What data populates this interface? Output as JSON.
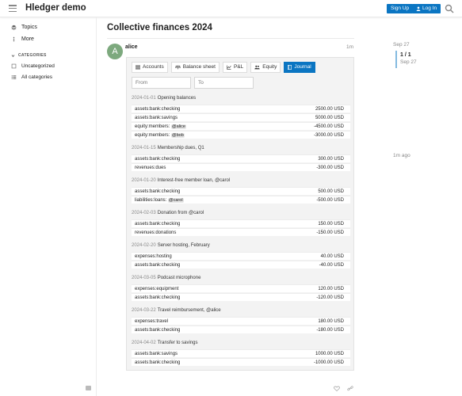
{
  "header": {
    "site_title": "Hledger demo",
    "signup_label": "Sign Up",
    "login_label": "Log In"
  },
  "sidebar": {
    "items": [
      {
        "label": "Topics",
        "icon": "layers-icon"
      },
      {
        "label": "More",
        "icon": "vertical-dots-icon"
      }
    ],
    "section_label": "CATEGORIES",
    "categories": [
      {
        "label": "Uncategorized",
        "icon": "square-icon"
      },
      {
        "label": "All categories",
        "icon": "list-icon"
      }
    ]
  },
  "topic": {
    "title": "Collective finances 2024"
  },
  "post": {
    "avatar_letter": "A",
    "username": "alice",
    "time": "1m",
    "tabs": [
      {
        "label": "Accounts",
        "icon": "list-icon",
        "active": false
      },
      {
        "label": "Balance sheet",
        "icon": "scale-icon",
        "active": false
      },
      {
        "label": "P&L",
        "icon": "chart-line-icon",
        "active": false
      },
      {
        "label": "Equity",
        "icon": "users-icon",
        "active": false
      },
      {
        "label": "Journal",
        "icon": "book-icon",
        "active": true
      }
    ],
    "from_placeholder": "From",
    "to_placeholder": "To",
    "transactions": [
      {
        "date": "2024-01-01",
        "desc": "Opening balances",
        "postings": [
          {
            "account": "assets:bank:checking",
            "amount": "2500.00 USD"
          },
          {
            "account": "assets:bank:savings",
            "amount": "5000.00 USD"
          },
          {
            "account": "equity:members: ",
            "mention": "@alice",
            "amount": "-4500.00 USD"
          },
          {
            "account": "equity:members: ",
            "mention": "@bob",
            "amount": "-3000.00 USD"
          }
        ]
      },
      {
        "date": "2024-01-15",
        "desc": "Membership dues, Q1",
        "postings": [
          {
            "account": "assets:bank:checking",
            "amount": "300.00 USD"
          },
          {
            "account": "revenues:dues",
            "amount": "-300.00 USD"
          }
        ]
      },
      {
        "date": "2024-01-20",
        "desc": "Interest-free member loan, @carol",
        "postings": [
          {
            "account": "assets:bank:checking",
            "amount": "500.00 USD"
          },
          {
            "account": "liabilities:loans: ",
            "mention": "@carol",
            "amount": "-500.00 USD"
          }
        ]
      },
      {
        "date": "2024-02-03",
        "desc": "Donation from @carol",
        "postings": [
          {
            "account": "assets:bank:checking",
            "amount": "150.00 USD"
          },
          {
            "account": "revenues:donations",
            "amount": "-150.00 USD"
          }
        ]
      },
      {
        "date": "2024-02-20",
        "desc": "Server hosting, February",
        "postings": [
          {
            "account": "expenses:hosting",
            "amount": "40.00 USD"
          },
          {
            "account": "assets:bank:checking",
            "amount": "-40.00 USD"
          }
        ]
      },
      {
        "date": "2024-03-05",
        "desc": "Podcast microphone",
        "postings": [
          {
            "account": "expenses:equipment",
            "amount": "120.00 USD"
          },
          {
            "account": "assets:bank:checking",
            "amount": "-120.00 USD"
          }
        ]
      },
      {
        "date": "2024-03-22",
        "desc": "Travel reimbursement, @alice",
        "postings": [
          {
            "account": "expenses:travel",
            "amount": "180.00 USD"
          },
          {
            "account": "assets:bank:checking",
            "amount": "-180.00 USD"
          }
        ]
      },
      {
        "date": "2024-04-02",
        "desc": "Transfer to savings",
        "postings": [
          {
            "account": "assets:bank:savings",
            "amount": "1000.00 USD"
          },
          {
            "account": "assets:bank:checking",
            "amount": "-1000.00 USD"
          }
        ]
      }
    ]
  },
  "timeline": {
    "top_date": "Sep 27",
    "position": "1 / 1",
    "current_date": "Sep 27",
    "bottom_label": "1m ago"
  },
  "colors": {
    "accent": "#0a75c2",
    "avatar": "#7da97e"
  }
}
